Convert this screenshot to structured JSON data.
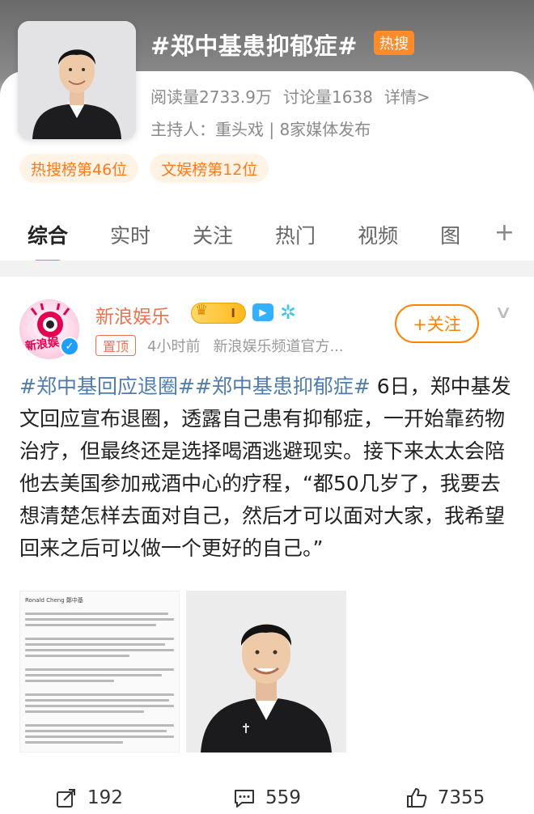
{
  "topic": {
    "title": "#郑中基患抑郁症#",
    "hot_badge": "热搜",
    "read_count": "阅读量2733.9万",
    "discuss_count": "讨论量1638",
    "details_link": "详情>",
    "host": "主持人：重头戏 | 8家媒体发布",
    "chips": [
      "热搜榜第46位",
      "文娱榜第12位"
    ]
  },
  "tabs": {
    "items": [
      "综合",
      "实时",
      "关注",
      "热门",
      "视频",
      "图"
    ],
    "active_index": 0,
    "plus": "+"
  },
  "post": {
    "avatar_text": "新浪娱",
    "author": "新浪娱乐",
    "vip_level": "I",
    "follow_label": "+关注",
    "pin_label": "置顶",
    "time": "4小时前",
    "source": "新浪娱乐频道官方...",
    "hashtag1": "#郑中基回应退圈#",
    "hashtag2": "#郑中基患抑郁症#",
    "text": " 6日，郑中基发文回应宣布退圈，透露自己患有抑郁症，一开始靠药物治疗，但最终还是选择喝酒逃避现实。接下来太太会陪他去美国参加戒酒中心的疗程，“都50几岁了，我要去想清楚怎样去面对自己，然后才可以面对大家，我希望回来之后可以做一个更好的自己。”",
    "doc_image_header": "Ronald Cheng 鄭中基"
  },
  "actions": {
    "share_count": "192",
    "comment_count": "559",
    "like_count": "7355"
  },
  "colors": {
    "accent": "#ff8200",
    "hashtag": "#507daf",
    "author": "#eb7350"
  }
}
